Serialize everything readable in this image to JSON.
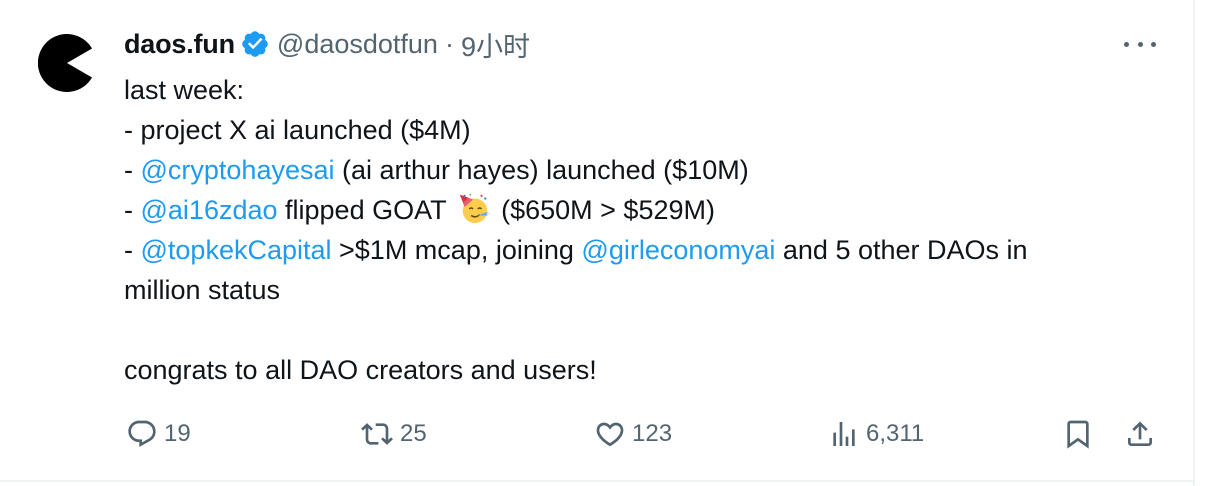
{
  "author": {
    "display_name": "daos.fun",
    "handle": "@daosdotfun",
    "separator": "·",
    "time": "9小时"
  },
  "body": {
    "line1": "last week:",
    "line2": "- project X ai launched ($4M)",
    "line3_prefix": "- ",
    "line3_mention": "@cryptohayesai",
    "line3_rest": " (ai arthur hayes) launched ($10M)",
    "line4_prefix": "- ",
    "line4_mention": "@ai16zdao",
    "line4_mid": " flipped GOAT ",
    "line4_emoji": "partying-face-emoji",
    "line4_rest": " ($650M > $529M)",
    "line5_prefix": "- ",
    "line5_mention1": "@topkekCapital",
    "line5_mid": " >$1M mcap, joining ",
    "line5_mention2": "@girleconomyai",
    "line5_rest": " and 5 other DAOs in",
    "line6": "million status",
    "line7": "congrats to all DAO creators and users!"
  },
  "actions": {
    "replies": "19",
    "reposts": "25",
    "likes": "123",
    "views": "6,311"
  },
  "icons": {
    "avatar": "pacman-logo",
    "verified": "verified-badge-icon",
    "more": "more-icon",
    "reply": "reply-icon",
    "repost": "repost-icon",
    "like": "heart-icon",
    "views": "views-icon",
    "bookmark": "bookmark-icon",
    "share": "share-icon"
  },
  "colors": {
    "text": "#0f1419",
    "secondary": "#536471",
    "mention": "#1d9bf0",
    "verified": "#1d9bf0",
    "border": "#eff3f4"
  }
}
